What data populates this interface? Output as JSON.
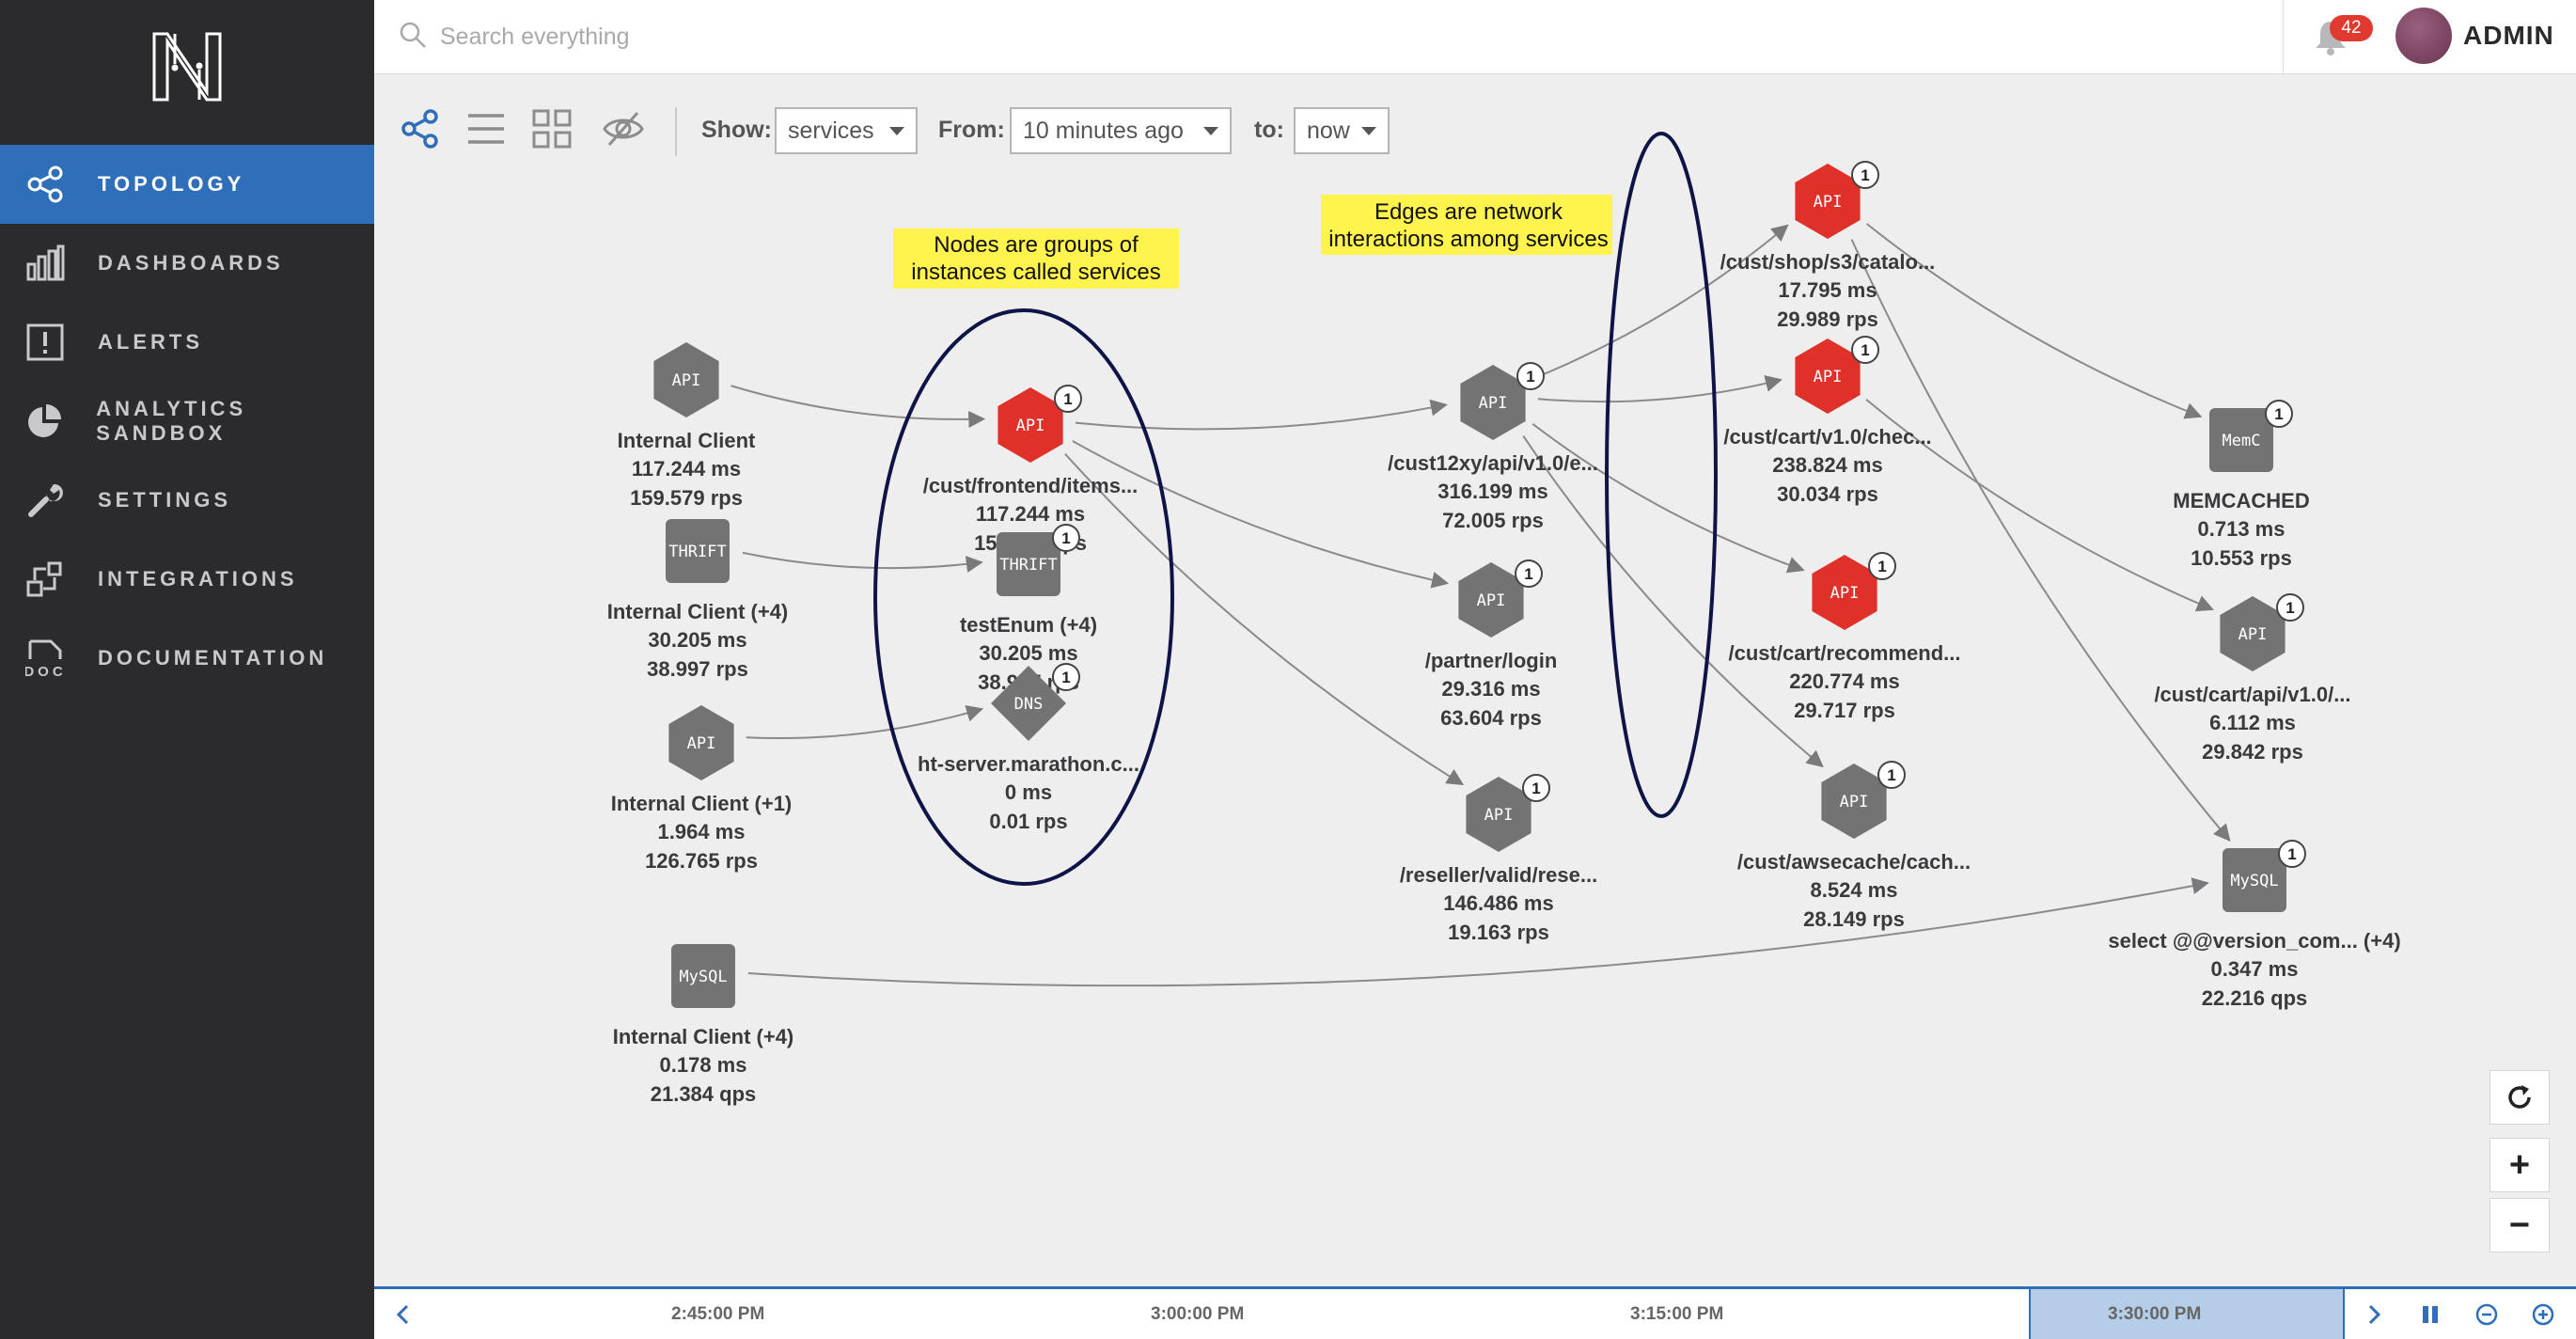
{
  "app": {
    "logo_letter": "N"
  },
  "sidebar": {
    "items": [
      {
        "label": "TOPOLOGY",
        "icon": "topology-icon",
        "active": true
      },
      {
        "label": "DASHBOARDS",
        "icon": "bar-chart-icon",
        "active": false
      },
      {
        "label": "ALERTS",
        "icon": "alert-icon",
        "active": false
      },
      {
        "label": "ANALYTICS SANDBOX",
        "icon": "pie-chart-icon",
        "active": false
      },
      {
        "label": "SETTINGS",
        "icon": "wrench-icon",
        "active": false
      },
      {
        "label": "INTEGRATIONS",
        "icon": "integrations-icon",
        "active": false
      },
      {
        "label": "DOCUMENTATION",
        "icon": "doc-icon",
        "active": false
      }
    ]
  },
  "header": {
    "search_placeholder": "Search everything",
    "notification_count": "42",
    "user_name": "ADMIN"
  },
  "toolbar": {
    "show_label": "Show:",
    "show_value": "services",
    "from_label": "From:",
    "from_value": "10 minutes ago",
    "to_label": "to:",
    "to_value": "now"
  },
  "annotations": {
    "nodes_note": [
      "Nodes are groups of",
      "instances called services"
    ],
    "edges_note": [
      "Edges are network",
      "interactions among services"
    ]
  },
  "nodes": [
    {
      "id": "ic1",
      "type": "API",
      "shape": "hex",
      "color": "#737373",
      "name": "Internal Client",
      "latency": "117.244 ms",
      "rate": "159.579 rps",
      "count": ""
    },
    {
      "id": "ic2",
      "type": "THRIFT",
      "shape": "rounded",
      "color": "#737373",
      "name": "Internal Client (+4)",
      "latency": "30.205 ms",
      "rate": "38.997 rps",
      "count": ""
    },
    {
      "id": "ic3",
      "type": "API",
      "shape": "hex",
      "color": "#737373",
      "name": "Internal Client (+1)",
      "latency": "1.964 ms",
      "rate": "126.765 rps",
      "count": ""
    },
    {
      "id": "ic4",
      "type": "MySQL",
      "shape": "rounded",
      "color": "#737373",
      "name": "Internal Client (+4)",
      "latency": "0.178 ms",
      "rate": "21.384 qps",
      "count": ""
    },
    {
      "id": "frontend",
      "type": "API",
      "shape": "hex",
      "color": "#e0302a",
      "name": "/cust/frontend/items...",
      "latency": "117.244 ms",
      "rate": "159.579 rps",
      "count": "1"
    },
    {
      "id": "testenum",
      "type": "THRIFT",
      "shape": "rounded",
      "color": "#737373",
      "name": "testEnum (+4)",
      "latency": "30.205 ms",
      "rate": "38.997 rps",
      "count": "1"
    },
    {
      "id": "dns",
      "type": "DNS",
      "shape": "diamond",
      "color": "#737373",
      "name": "ht-server.marathon.c...",
      "latency": "0 ms",
      "rate": "0.01 rps",
      "count": "1"
    },
    {
      "id": "cust12xy",
      "type": "API",
      "shape": "hex",
      "color": "#737373",
      "name": "/cust12xy/api/v1.0/e...",
      "latency": "316.199 ms",
      "rate": "72.005 rps",
      "count": "1"
    },
    {
      "id": "login",
      "type": "API",
      "shape": "hex",
      "color": "#737373",
      "name": "/partner/login",
      "latency": "29.316 ms",
      "rate": "63.604 rps",
      "count": "1"
    },
    {
      "id": "reseller",
      "type": "API",
      "shape": "hex",
      "color": "#737373",
      "name": "/reseller/valid/rese...",
      "latency": "146.486 ms",
      "rate": "19.163 rps",
      "count": "1"
    },
    {
      "id": "catalog",
      "type": "API",
      "shape": "hex",
      "color": "#e0302a",
      "name": "/cust/shop/s3/catalo...",
      "latency": "17.795 ms",
      "rate": "29.989 rps",
      "count": "1"
    },
    {
      "id": "checkout",
      "type": "API",
      "shape": "hex",
      "color": "#e0302a",
      "name": "/cust/cart/v1.0/chec...",
      "latency": "238.824 ms",
      "rate": "30.034 rps",
      "count": "1"
    },
    {
      "id": "recommend",
      "type": "API",
      "shape": "hex",
      "color": "#e0302a",
      "name": "/cust/cart/recommend...",
      "latency": "220.774 ms",
      "rate": "29.717 rps",
      "count": "1"
    },
    {
      "id": "awsecache",
      "type": "API",
      "shape": "hex",
      "color": "#737373",
      "name": "/cust/awsecache/cach...",
      "latency": "8.524 ms",
      "rate": "28.149 rps",
      "count": "1"
    },
    {
      "id": "memcached",
      "type": "MemC",
      "shape": "rounded",
      "color": "#737373",
      "name": "MEMCACHED",
      "latency": "0.713 ms",
      "rate": "10.553 rps",
      "count": "1"
    },
    {
      "id": "cartapi",
      "type": "API",
      "shape": "hex",
      "color": "#737373",
      "name": "/cust/cart/api/v1.0/...",
      "latency": "6.112 ms",
      "rate": "29.842 rps",
      "count": "1"
    },
    {
      "id": "mysql",
      "type": "MySQL",
      "shape": "rounded",
      "color": "#737373",
      "name": "select @@version_com... (+4)",
      "latency": "0.347 ms",
      "rate": "22.216 qps",
      "count": "1"
    }
  ],
  "edges": [
    [
      "ic1",
      "frontend"
    ],
    [
      "ic2",
      "testenum"
    ],
    [
      "ic3",
      "dns"
    ],
    [
      "ic4",
      "mysql"
    ],
    [
      "frontend",
      "cust12xy"
    ],
    [
      "frontend",
      "login"
    ],
    [
      "frontend",
      "reseller"
    ],
    [
      "cust12xy",
      "catalog"
    ],
    [
      "cust12xy",
      "checkout"
    ],
    [
      "cust12xy",
      "recommend"
    ],
    [
      "cust12xy",
      "awsecache"
    ],
    [
      "catalog",
      "memcached"
    ],
    [
      "catalog",
      "mysql"
    ],
    [
      "checkout",
      "cartapi"
    ]
  ],
  "controls": {
    "refresh": "refresh-icon",
    "zoom_in": "+",
    "zoom_out": "−"
  },
  "timeline": {
    "ticks": [
      "2:45:00 PM",
      "3:00:00 PM",
      "3:15:00 PM",
      "3:30:00 PM"
    ],
    "selected": "3:30:00 PM"
  },
  "colors": {
    "accent": "#2f6fb9",
    "alert_node": "#e0302a",
    "normal_node": "#737373",
    "sidebar": "#2b2b2d",
    "note_bg": "#fff34d"
  }
}
